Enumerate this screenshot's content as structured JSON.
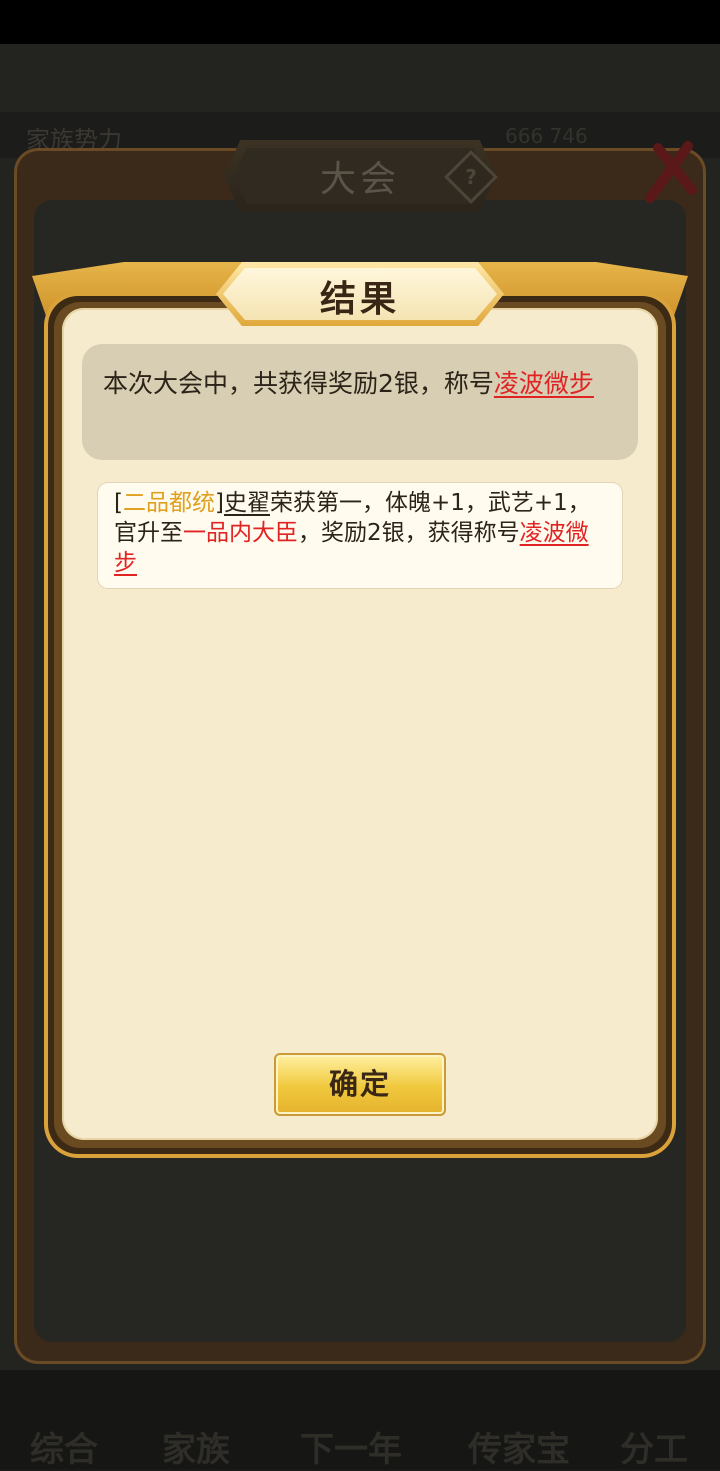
{
  "background": {
    "family_label": "家族势力",
    "resource_text": "666 746",
    "nav": [
      "综合",
      "家族",
      "下一年",
      "传家宝",
      "分工"
    ]
  },
  "outer_panel": {
    "title": "大会",
    "help_icon": "?"
  },
  "dialog": {
    "title": "结果",
    "summary": {
      "prefix": "本次大会中，共获得奖励2银，称号",
      "title_link": "凌波微步"
    },
    "detail": {
      "bracket_open": "[",
      "rank": "二品都统",
      "bracket_close": "]",
      "name": "史翟",
      "text1": "荣获第一，体魄+1，武艺+1，官升至",
      "position": "一品内大臣",
      "text2": "，奖励2银，获得称号",
      "title_link": "凌波微步"
    },
    "ok_label": "确定"
  },
  "colors": {
    "accent_red": "#e02424",
    "accent_gold": "#e0a020",
    "parchment": "#f6eccd"
  }
}
